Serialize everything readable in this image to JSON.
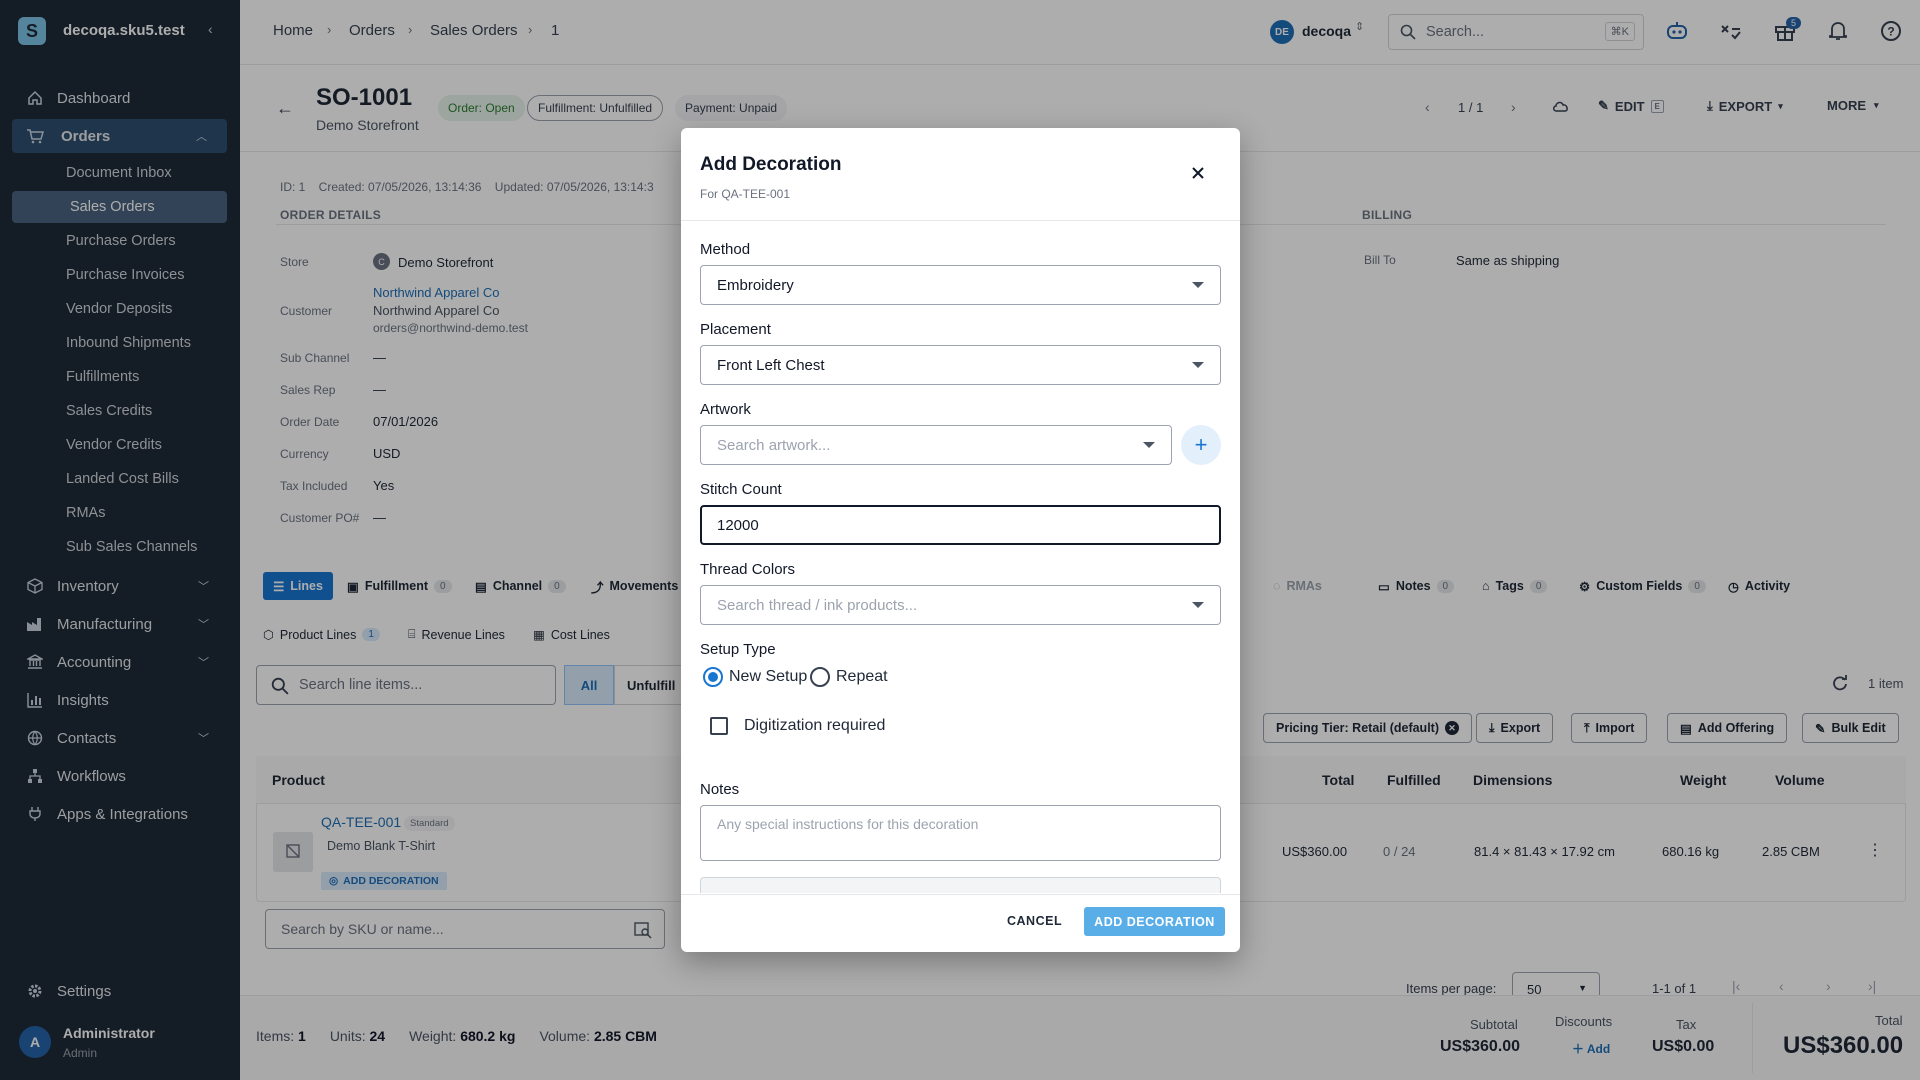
{
  "sidebar": {
    "workspace": "decoqa.sku5.test",
    "nav": [
      {
        "label": "Dashboard",
        "icon": "home-icon"
      },
      {
        "label": "Orders",
        "icon": "cart-icon"
      },
      {
        "label": "Inventory",
        "icon": "box-icon"
      },
      {
        "label": "Manufacturing",
        "icon": "factory-icon"
      },
      {
        "label": "Accounting",
        "icon": "bank-icon"
      },
      {
        "label": "Insights",
        "icon": "chart-icon"
      },
      {
        "label": "Contacts",
        "icon": "globe-icon"
      },
      {
        "label": "Workflows",
        "icon": "workflow-icon"
      },
      {
        "label": "Apps & Integrations",
        "icon": "plug-icon"
      }
    ],
    "orders_sub": [
      "Document Inbox",
      "Sales Orders",
      "Purchase Orders",
      "Purchase Invoices",
      "Vendor Deposits",
      "Inbound Shipments",
      "Fulfillments",
      "Sales Credits",
      "Vendor Credits",
      "Landed Cost Bills",
      "RMAs",
      "Sub Sales Channels"
    ],
    "settings": "Settings",
    "user": {
      "initial": "A",
      "name": "Administrator",
      "role": "Admin"
    }
  },
  "topbar": {
    "breadcrumbs": [
      "Home",
      "Orders",
      "Sales Orders",
      "1"
    ],
    "account_initials": "DE",
    "account": "decoqa",
    "search_placeholder": "Search...",
    "search_shortcut": "⌘K",
    "gift_badge": "5"
  },
  "order": {
    "number": "SO-1001",
    "store": "Demo Storefront",
    "status_order": "Order: Open",
    "status_fulfillment": "Fulfillment: Unfulfilled",
    "status_payment": "Payment: Unpaid",
    "pager": "1 / 1",
    "edit": "EDIT",
    "edit_key": "E",
    "export": "EXPORT",
    "more": "MORE",
    "meta": "ID: 1    Created: 07/05/2026, 13:14:36    Updated: 07/05/2026, 13:14:3",
    "section_details": "ORDER DETAILS",
    "section_billing": "BILLING",
    "bill_to_label": "Bill To",
    "bill_to_value": "Same as shipping",
    "details": [
      {
        "label": "Store",
        "value": "Demo Storefront"
      },
      {
        "label": "Customer",
        "value": "Northwind Apparel Co"
      },
      {
        "label": "Sub Channel",
        "value": "—"
      },
      {
        "label": "Sales Rep",
        "value": "—"
      },
      {
        "label": "Order Date",
        "value": "07/01/2026"
      },
      {
        "label": "Currency",
        "value": "USD"
      },
      {
        "label": "Tax Included",
        "value": "Yes"
      },
      {
        "label": "Customer PO#",
        "value": "—"
      }
    ],
    "store_initial": "C",
    "customer_line2": "Northwind Apparel Co",
    "customer_email": "orders@northwind-demo.test"
  },
  "tabs": [
    {
      "label": "Lines",
      "count": ""
    },
    {
      "label": "Fulfillment",
      "count": "0"
    },
    {
      "label": "Channel",
      "count": "0"
    },
    {
      "label": "Movements",
      "count": ""
    },
    {
      "label": "RMAs",
      "count": ""
    },
    {
      "label": "Notes",
      "count": "0"
    },
    {
      "label": "Tags",
      "count": "0"
    },
    {
      "label": "Custom Fields",
      "count": "0"
    },
    {
      "label": "Activity",
      "count": ""
    }
  ],
  "subtabs": {
    "product_lines": "Product Lines",
    "product_count": "1",
    "revenue_lines": "Revenue Lines",
    "cost_lines": "Cost Lines"
  },
  "lines": {
    "search_placeholder": "Search line items...",
    "filter_all": "All",
    "filter_unfulfilled": "Unfulfill",
    "item_count": "1 item",
    "pricing_tier": "Pricing Tier: Retail (default)",
    "btn_export": "Export",
    "btn_import": "Import",
    "btn_add_offering": "Add Offering",
    "btn_bulk_edit": "Bulk Edit",
    "columns": {
      "product": "Product",
      "total": "Total",
      "fulfilled": "Fulfilled",
      "dimensions": "Dimensions",
      "weight": "Weight",
      "volume": "Volume"
    },
    "row": {
      "sku": "QA-TEE-001",
      "type": "Standard",
      "name": "Demo Blank T-Shirt",
      "add_decoration": "ADD DECORATION",
      "total": "US$360.00",
      "fulfilled": "0 / 24",
      "dimensions": "81.4 × 81.43 × 17.92 cm",
      "weight": "680.16 kg",
      "volume": "2.85 CBM"
    },
    "sku_search_placeholder": "Search by SKU or name...",
    "items_per_page_label": "Items per page:",
    "items_per_page": "50",
    "range": "1-1 of 1"
  },
  "footer": {
    "items_label": "Items:",
    "items": "1",
    "units_label": "Units:",
    "units": "24",
    "weight_label": "Weight:",
    "weight": "680.2 kg",
    "volume_label": "Volume:",
    "volume": "2.85 CBM",
    "subtotal_label": "Subtotal",
    "subtotal": "US$360.00",
    "discounts_label": "Discounts",
    "discounts_add": "Add",
    "tax_label": "Tax",
    "tax": "US$0.00",
    "total_label": "Total",
    "total": "US$360.00"
  },
  "modal": {
    "title": "Add Decoration",
    "subtitle": "For QA-TEE-001",
    "method_label": "Method",
    "method_value": "Embroidery",
    "placement_label": "Placement",
    "placement_value": "Front Left Chest",
    "artwork_label": "Artwork",
    "artwork_placeholder": "Search artwork...",
    "stitch_label": "Stitch Count",
    "stitch_value": "12000",
    "thread_label": "Thread Colors",
    "thread_placeholder": "Search thread / ink products...",
    "setup_label": "Setup Type",
    "setup_options": [
      "New Setup",
      "Repeat"
    ],
    "digitization_label": "Digitization required",
    "notes_label": "Notes",
    "notes_placeholder": "Any special instructions for this decoration",
    "cancel": "CANCEL",
    "submit": "ADD DECORATION"
  },
  "colors": {
    "sidebar": "#1e2a38",
    "accent": "#1976d2",
    "submit": "#5aaee8"
  }
}
